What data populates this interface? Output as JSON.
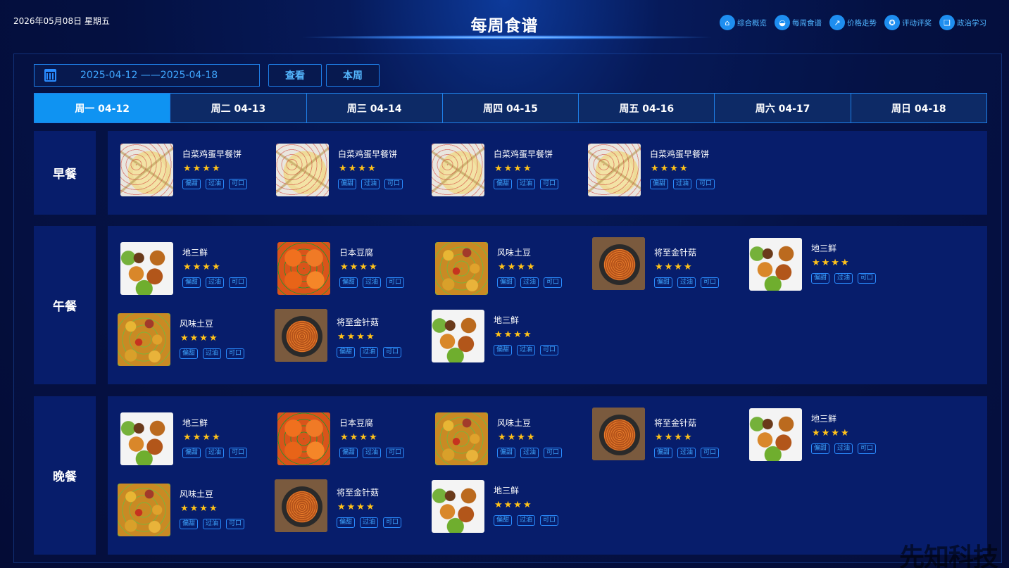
{
  "header": {
    "date": "2026年05月08日  星期五",
    "title": "每周食谱",
    "nav": [
      {
        "label": "综合概览",
        "icon": "home-icon",
        "glyph": "⌂"
      },
      {
        "label": "每周食谱",
        "icon": "bowl-icon",
        "glyph": "◒"
      },
      {
        "label": "价格走势",
        "icon": "trend-icon",
        "glyph": "↗"
      },
      {
        "label": "评动评奖",
        "icon": "award-icon",
        "glyph": "✪"
      },
      {
        "label": "政治学习",
        "icon": "book-icon",
        "glyph": "❑"
      }
    ]
  },
  "toolbar": {
    "range": "2025-04-12  ——2025-04-18",
    "view_label": "查看",
    "week_label": "本周"
  },
  "tabs": [
    "周一 04-12",
    "周二 04-13",
    "周三 04-14",
    "周四 04-15",
    "周五 04-16",
    "周六 04-17",
    "周日 04-18"
  ],
  "meals": {
    "breakfast": {
      "label": "早餐"
    },
    "lunch": {
      "label": "午餐"
    },
    "dinner": {
      "label": "晚餐"
    }
  },
  "dishes": {
    "pizza": "白菜鸡蛋早餐饼",
    "sanxian": "地三鲜",
    "tofu": "日本豆腐",
    "potato": "风味土豆",
    "noodle": "将至金针菇"
  },
  "tags": [
    "偏甜",
    "过油",
    "可口"
  ],
  "stars": "★★★★",
  "watermark": "先知科技"
}
